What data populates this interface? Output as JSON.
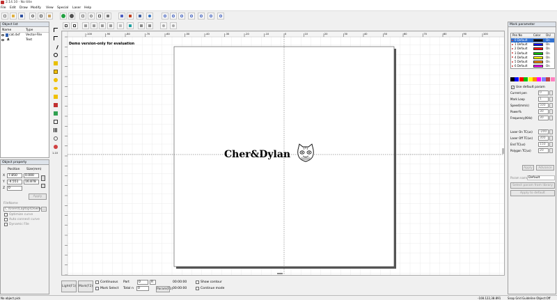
{
  "window": {
    "title": "2.14.10 - No title"
  },
  "menu": [
    "File",
    "Edit",
    "Draw",
    "Modify",
    "View",
    "Special",
    "Laser",
    "Help"
  ],
  "object_list": {
    "title": "Object list",
    "headers": [
      "Name",
      "Type"
    ],
    "rows": [
      {
        "name": "cat.dxf",
        "type": "Vector-File"
      },
      {
        "name": "A",
        "type": "Text"
      }
    ]
  },
  "object_property": {
    "title": "Object property",
    "pos_header": "Position",
    "size_header": "Size(mm)",
    "rows": [
      {
        "axis": "X",
        "pos": "7.850",
        "size": "0.000"
      },
      {
        "axis": "Y",
        "pos": "-4.551",
        "size": "16.878"
      },
      {
        "axis": "Z",
        "pos": "0",
        "size": ""
      }
    ],
    "apply": "Apply",
    "filename_label": "FileName",
    "filename": "C:\\Users\\Laptop\\Downlo",
    "browse": "...",
    "optimize": "Optimize curve",
    "auto_connect": "Auto connect curve",
    "dynamic": "Dynamic File"
  },
  "canvas": {
    "demo_text": "Demo version-only for evaluation",
    "art_text": "Cher&Dylan",
    "ruler_labels": [
      "-100",
      "-90",
      "-80",
      "-70",
      "-60",
      "-50",
      "-40",
      "-30",
      "-20",
      "-10",
      "0",
      "10",
      "20",
      "30",
      "40",
      "50",
      "60",
      "70",
      "80",
      "90",
      "100"
    ]
  },
  "bottom": {
    "light": "Light(F1)",
    "mark": "Mark(F2)",
    "continuous": "Continuous",
    "part_label": "Part",
    "part_value": "0",
    "part_r": "R",
    "mark_select": "Mark Select",
    "total_label": "Total n",
    "total_value": "0",
    "param": "Param(F3)",
    "time1": "00:00:00",
    "time2": "00:00:00",
    "show_contour": "Show contour",
    "continue_mode": "Continue mode"
  },
  "mark_parameter": {
    "title": "Mark parameter",
    "headers": [
      "Pen No",
      "Color",
      "On/"
    ],
    "pens": [
      {
        "name": "0 Default",
        "color": "#000000",
        "on": "On"
      },
      {
        "name": "1 Default",
        "color": "#0000ff",
        "on": "On"
      },
      {
        "name": "2 Default",
        "color": "#ff0000",
        "on": "On"
      },
      {
        "name": "3 Default",
        "color": "#00c000",
        "on": "On"
      },
      {
        "name": "4 Default",
        "color": "#ffff00",
        "on": "On"
      },
      {
        "name": "5 Default",
        "color": "#ff8c00",
        "on": "On"
      },
      {
        "name": "6 Default",
        "color": "#ff00ff",
        "on": "On"
      }
    ],
    "palette": [
      "#000000",
      "#0000ff",
      "#ff0000",
      "#00c000",
      "#ffff00",
      "#ff8c00",
      "#ff00ff",
      "#8080ff",
      "#c04040",
      "#ff80c0"
    ],
    "use_default": "Use default param",
    "fields": [
      {
        "label": "Current pen",
        "value": "0"
      },
      {
        "label": "Mark Loop",
        "value": "1"
      },
      {
        "label": "Speed(mm/s)",
        "value": "500"
      },
      {
        "label": "Power%",
        "value": "30"
      },
      {
        "label": "Frequency(KHz)",
        "value": "30"
      }
    ],
    "fields2": [
      {
        "label": "Laser On TC(us)",
        "value": "-200"
      },
      {
        "label": "Laser Off TC(us)",
        "value": "300"
      },
      {
        "label": "End TC(us)",
        "value": "150"
      },
      {
        "label": "Polygon TC(us)",
        "value": "20"
      }
    ],
    "apply_label": "Apply",
    "advance_label": "Advance",
    "param_name_label": "Param name",
    "param_name_value": "Default",
    "select_param": "Select param from library",
    "apply_default": "Apply to default"
  },
  "status": {
    "left": "No object pick",
    "coords": "-108.122,38.891",
    "snap": "Snap Grid Guideline Object:Off"
  }
}
